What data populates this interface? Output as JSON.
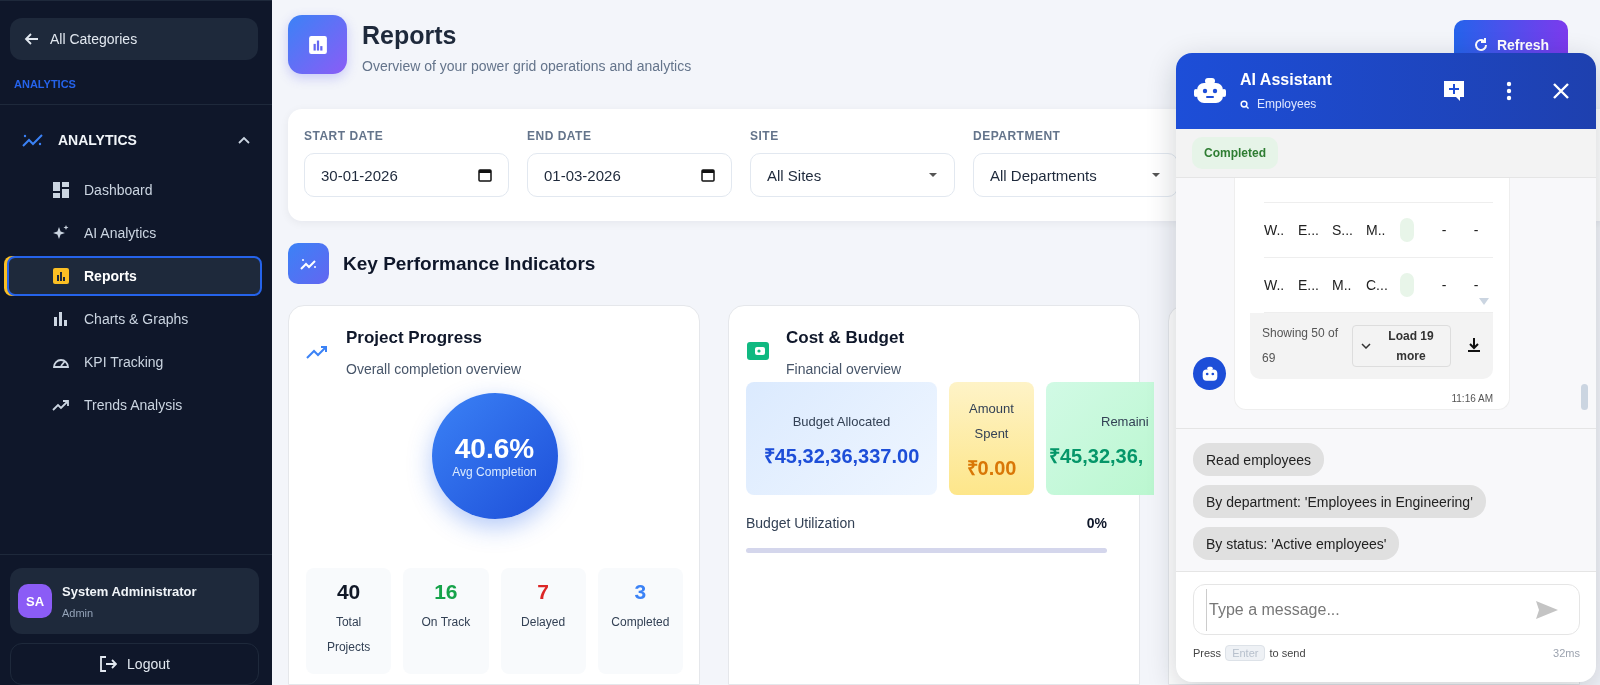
{
  "sidebar": {
    "back_button": "All Categories",
    "section_label": "ANALYTICS",
    "group": {
      "label": "ANALYTICS",
      "expanded": true,
      "items": [
        {
          "label": "Dashboard",
          "selected": false
        },
        {
          "label": "AI Analytics",
          "selected": false
        },
        {
          "label": "Reports",
          "selected": true
        },
        {
          "label": "Charts & Graphs",
          "selected": false
        },
        {
          "label": "KPI Tracking",
          "selected": false
        },
        {
          "label": "Trends Analysis",
          "selected": false
        }
      ]
    },
    "user": {
      "initials": "SA",
      "name": "System Administrator",
      "role": "Admin"
    },
    "logout": "Logout"
  },
  "header": {
    "title": "Reports",
    "subtitle": "Overview of your power grid operations and analytics",
    "refresh": "Refresh"
  },
  "filters": [
    {
      "label": "START DATE",
      "value": "30-01-2026",
      "kind": "date"
    },
    {
      "label": "END DATE",
      "value": "01-03-2026",
      "kind": "date"
    },
    {
      "label": "SITE",
      "value": "All Sites",
      "kind": "select"
    },
    {
      "label": "DEPARTMENT",
      "value": "All Departments",
      "kind": "select"
    }
  ],
  "kpi": {
    "title": "Key Performance Indicators",
    "progress": {
      "title": "Project Progress",
      "subtitle": "Overall completion overview",
      "percent": "40.6%",
      "percent_label": "Avg Completion",
      "stats": [
        {
          "value": "40",
          "label": "Total Projects",
          "color": "#111827"
        },
        {
          "value": "16",
          "label": "On Track",
          "color": "#16a34a"
        },
        {
          "value": "7",
          "label": "Delayed",
          "color": "#dc2626"
        },
        {
          "value": "3",
          "label": "Completed",
          "color": "#3b82f6"
        }
      ]
    },
    "budget": {
      "title": "Cost & Budget",
      "subtitle": "Financial overview",
      "boxes": [
        {
          "label": "Budget Allocated",
          "value": "₹45,32,36,337.00",
          "kind": "allocated"
        },
        {
          "label": "Amount Spent",
          "value": "₹0.00",
          "kind": "spent"
        },
        {
          "label": "Remaini",
          "value": "₹45,32,36,",
          "kind": "remaining"
        }
      ],
      "utilization_label": "Budget Utilization",
      "utilization_value": "0%",
      "level": 0
    }
  },
  "chat": {
    "title": "AI Assistant",
    "context": "Employees",
    "status": "Completed",
    "table_rows": [
      [
        "W..",
        "E...",
        "S...",
        "M..",
        "-",
        "-"
      ],
      [
        "W..",
        "E...",
        "M..",
        "C...",
        "-",
        "-"
      ]
    ],
    "showing": "Showing 50 of 69",
    "load_more": "Load 19 more",
    "time": "11:16 AM",
    "suggestions": [
      "Read employees",
      "By department: 'Employees in Engineering'",
      "By status: 'Active employees'"
    ],
    "placeholder": "Type a message...",
    "hint_press": "Press",
    "hint_key": "Enter",
    "hint_send": "to send",
    "latency": "32ms"
  }
}
